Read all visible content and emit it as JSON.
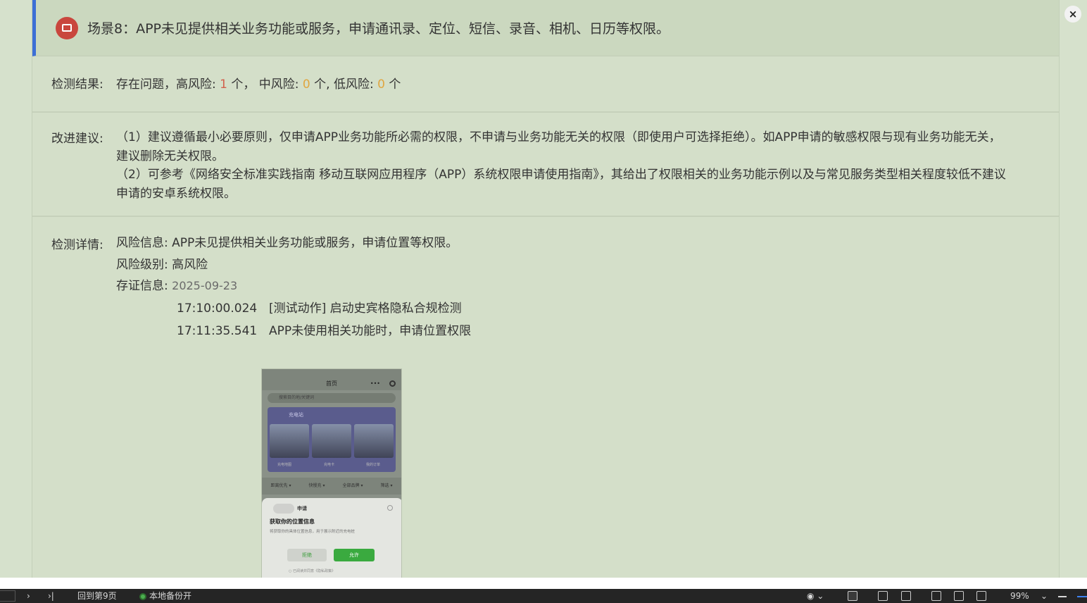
{
  "header": {
    "title": "场景8：APP未见提供相关业务功能或服务，申请通讯录、定位、短信、录音、相机、日历等权限。"
  },
  "result": {
    "label": "检测结果:",
    "prefix": "存在问题，高风险:",
    "high": "1",
    "mid_prefix": "个，  中风险:",
    "mid": "0",
    "low_prefix": "个, 低风险:",
    "low": "0",
    "suffix": "个"
  },
  "advice": {
    "label": "改进建议:",
    "p1": "（1）建议遵循最小必要原则，仅申请APP业务功能所必需的权限，不申请与业务功能无关的权限（即使用户可选择拒绝）。如APP申请的敏感权限与现有业务功能无关，建议删除无关权限。",
    "p2": "（2）可参考《网络安全标准实践指南 移动互联网应用程序（APP）系统权限申请使用指南》，其给出了权限相关的业务功能示例以及与常见服务类型相关程度较低不建议申请的安卓系统权限。"
  },
  "detail": {
    "label": "检测详情:",
    "risk_info": "风险信息: APP未见提供相关业务功能或服务，申请位置等权限。",
    "risk_level": "风险级别: 高风险",
    "evidence_label": "存证信息:",
    "evidence_date": "2025-09-23",
    "evidence": [
      {
        "time": "17:10:00.024",
        "text": "[测试动作] 启动史宾格隐私合规检测"
      },
      {
        "time": "17:11:35.541",
        "text": "APP未使用相关功能时，申请位置权限"
      }
    ]
  },
  "phone": {
    "page_title": "首页",
    "search_placeholder": "搜索目的地/关键词",
    "banner_tag": "充电站",
    "car_labels": [
      "充电地图",
      "充电卡",
      "我的订单"
    ],
    "tabs": [
      "距离优先 ▾",
      "快慢充 ▾",
      "全部品牌 ▾",
      "筛选 ▾"
    ],
    "dialog_app": "申请",
    "dialog_title": "获取你的位置信息",
    "dialog_desc": "将获取你的具体位置信息，用于展示附近的充电桩",
    "deny": "拒绝",
    "allow": "允许",
    "footer": "○ 已阅读并同意《隐私政策》"
  },
  "status_bar": {
    "back_page": "回到第9页",
    "backup": "本地备份开",
    "zoom": "99%"
  },
  "colors": {
    "accent_blue": "#3d6fd6",
    "risk_red": "#d2604c",
    "risk_orange": "#e0a640",
    "allow_green": "#3aaa3f"
  }
}
